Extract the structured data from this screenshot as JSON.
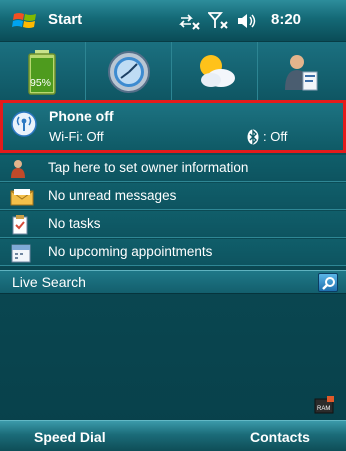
{
  "titlebar": {
    "start_label": "Start",
    "time": "8:20",
    "icons": [
      "start-flag-icon",
      "sync-arrows-icon",
      "signal-off-icon",
      "speaker-icon"
    ]
  },
  "apps": [
    {
      "name": "battery-icon",
      "label": "95%"
    },
    {
      "name": "clock-app-icon"
    },
    {
      "name": "weather-icon"
    },
    {
      "name": "contacts-app-icon"
    }
  ],
  "phone": {
    "title": "Phone off",
    "wifi": "Wi-Fi: Off",
    "bluetooth": ": Off"
  },
  "rows": {
    "owner": "Tap here to set owner information",
    "messages": "No unread messages",
    "tasks": "No tasks",
    "appointments": "No upcoming appointments"
  },
  "search": {
    "label": "Live Search"
  },
  "softkeys": {
    "left": "Speed Dial",
    "right": "Contacts"
  },
  "colors": {
    "highlight_border": "#e41b1b",
    "background": "#0f4d58"
  }
}
